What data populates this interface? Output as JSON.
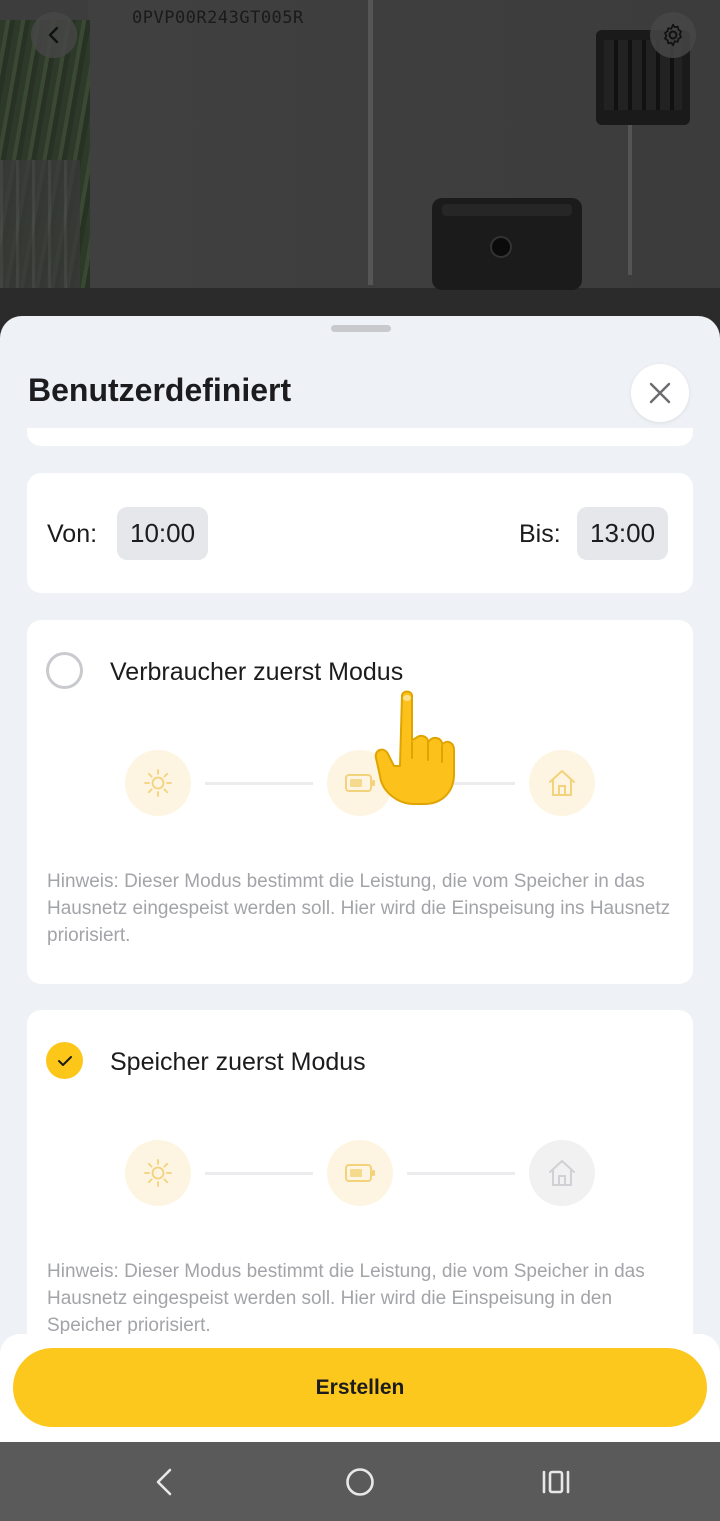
{
  "header": {
    "serial": "0PVP00R243GT005R",
    "back_icon": "chevron-left-icon",
    "settings_icon": "gear-icon"
  },
  "sheet": {
    "title": "Benutzerdefiniert",
    "close_icon": "close-icon"
  },
  "time_range": {
    "from_label": "Von:",
    "from_value": "10:00",
    "to_label": "Bis:",
    "to_value": "13:00"
  },
  "modes": [
    {
      "title": "Verbraucher zuerst Modus",
      "selected": false,
      "hint": "Hinweis: Dieser Modus bestimmt die Leistung, die vom Speicher in das Hausnetz eingespeist werden soll. Hier wird die Einspeisung ins Hausnetz priorisiert.",
      "flow_icons": [
        "sun-icon",
        "battery-icon",
        "house-icon"
      ]
    },
    {
      "title": "Speicher zuerst Modus",
      "selected": true,
      "hint": "Hinweis: Dieser Modus bestimmt die Leistung, die vom Speicher in das Hausnetz eingespeist werden soll. Hier wird die Einspeisung in den Speicher priorisiert.",
      "flow_icons": [
        "sun-icon",
        "battery-icon",
        "house-icon"
      ]
    }
  ],
  "footer": {
    "create_label": "Erstellen"
  },
  "colors": {
    "accent": "#fcc81e",
    "sheet_bg": "#eef1f5",
    "hint_text": "#a3a4a8"
  },
  "system_nav": {
    "icons": [
      "nav-back-icon",
      "nav-home-icon",
      "nav-recents-icon"
    ]
  }
}
